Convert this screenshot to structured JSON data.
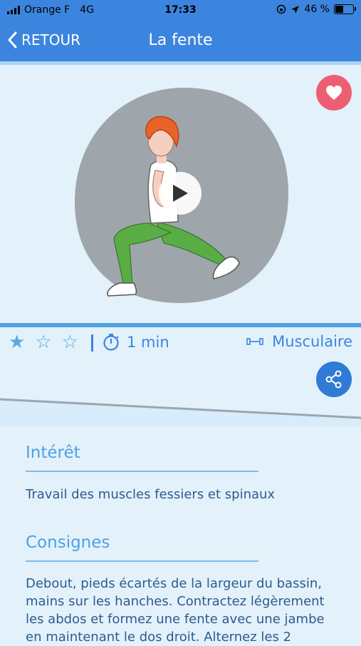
{
  "status_bar": {
    "carrier": "Orange F",
    "network": "4G",
    "time": "17:33",
    "battery_percent": "46 %",
    "battery_level": 0.46
  },
  "nav": {
    "back_label": "RETOUR",
    "title": "La fente"
  },
  "exercise": {
    "rating": 1,
    "max_rating": 3,
    "duration": "1 min",
    "category": "Musculaire"
  },
  "sections": {
    "interest": {
      "title": "Intérêt",
      "text": "Travail des muscles fessiers et spinaux"
    },
    "instructions": {
      "title": "Consignes",
      "text": "Debout, pieds écartés de la largeur du bassin, mains sur les hanches. Contractez légèrement les abdos et formez une fente avec une jambe en maintenant le dos droit. Alternez les 2"
    }
  },
  "colors": {
    "primary": "#3c85de",
    "background": "#e3f1fb",
    "favorite": "#ec5f73",
    "accent_text": "#4fa1e0",
    "body_text": "#2e5b8c",
    "pants": "#5aac44",
    "hair": "#e8632a"
  },
  "icons": {
    "back": "chevron-left-icon",
    "favorite": "heart-icon",
    "play": "play-icon",
    "rating": "star-icon",
    "duration": "stopwatch-icon",
    "category": "dumbbell-icon",
    "share": "share-icon"
  }
}
